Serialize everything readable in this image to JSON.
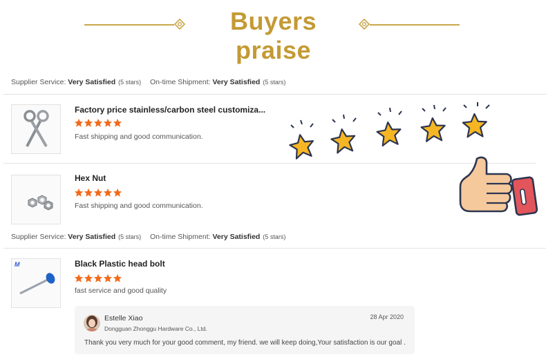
{
  "banner": {
    "title": "Buyers praise",
    "accent_color": "#c49a35"
  },
  "service_rows": [
    {
      "supplier_label": "Supplier Service:",
      "supplier_value": "Very Satisfied",
      "supplier_stars": "(5 stars)",
      "shipment_label": "On-time Shipment:",
      "shipment_value": "Very Satisfied",
      "shipment_stars": "(5 stars)"
    },
    {
      "supplier_label": "Supplier Service:",
      "supplier_value": "Very Satisfied",
      "supplier_stars": "(5 stars)",
      "shipment_label": "On-time Shipment:",
      "shipment_value": "Very Satisfied",
      "shipment_stars": "(5 stars)"
    }
  ],
  "reviews": [
    {
      "title": "Factory price stainless/carbon steel customiza...",
      "rating": 5,
      "comment": "Fast shipping and good communication.",
      "thumb_icon": "eye-bolt-icon"
    },
    {
      "title": "Hex Nut",
      "rating": 5,
      "comment": "Fast shipping and good communication.",
      "thumb_icon": "hex-nut-icon"
    },
    {
      "title": "Black Plastic head bolt",
      "rating": 5,
      "comment": "fast service and good quality",
      "thumb_icon": "plastic-head-bolt-icon"
    }
  ],
  "reply": {
    "name": "Estelle Xiao",
    "company": "Dongguan Zhonggu Hardware Co., Ltd.",
    "date": "28 Apr 2020",
    "text": "Thank you very much for your good comment, my friend. we will keep doing,Your satisfaction is our goal ."
  },
  "colors": {
    "star": "#f26a1b",
    "decor_star": "#f6b623",
    "thumb_up": "#f5c99b",
    "cuff": "#e2555b"
  },
  "decoration": {
    "stars_count": 5,
    "icon": "thumbs-up-icon"
  }
}
